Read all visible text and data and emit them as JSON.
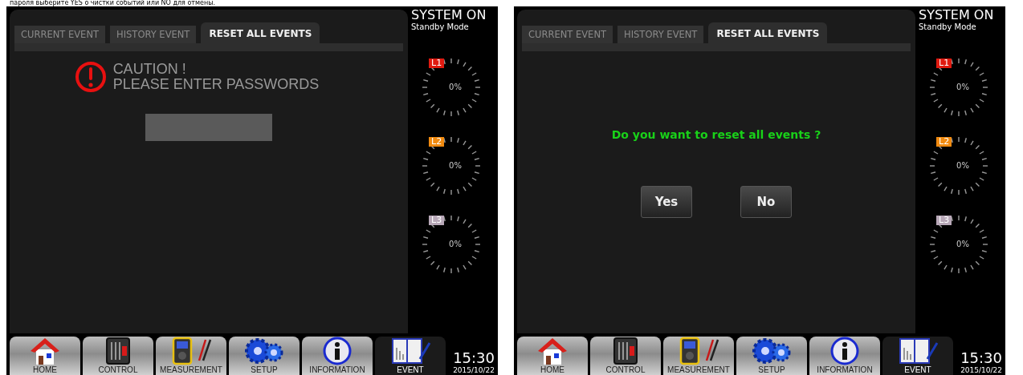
{
  "caption": "пароля выберите YES о чистки событий или NO для отмены.",
  "screens": [
    {
      "tabs": [
        {
          "label": "CURRENT EVENT",
          "selected": false
        },
        {
          "label": "HISTORY EVENT",
          "selected": false
        },
        {
          "label": "RESET ALL EVENTS",
          "selected": true
        }
      ],
      "content": {
        "kind": "password",
        "caution": "CAUTION !",
        "prompt": "PLEASE ENTER PASSWORDS"
      },
      "status": {
        "title": "SYSTEM ON",
        "mode": "Standby Mode"
      },
      "phases": [
        {
          "label": "L1",
          "color": "#e01a10",
          "reading": "0%"
        },
        {
          "label": "L2",
          "color": "#f08a10",
          "reading": "0%"
        },
        {
          "label": "L3",
          "color": "#b8a8b8",
          "reading": "0%"
        }
      ],
      "nav": [
        {
          "label": "HOME",
          "selected": false
        },
        {
          "label": "CONTROL",
          "selected": false
        },
        {
          "label": "MEASUREMENT",
          "selected": false
        },
        {
          "label": "SETUP",
          "selected": false
        },
        {
          "label": "INFORMATION",
          "selected": false
        },
        {
          "label": "EVENT",
          "selected": true
        }
      ],
      "clock": {
        "time": "15:30",
        "date": "2015/10/22"
      }
    },
    {
      "tabs": [
        {
          "label": "CURRENT EVENT",
          "selected": false
        },
        {
          "label": "HISTORY EVENT",
          "selected": false
        },
        {
          "label": "RESET ALL EVENTS",
          "selected": true
        }
      ],
      "content": {
        "kind": "confirm",
        "question": "Do you want to reset all events ?",
        "buttons": [
          "Yes",
          "No"
        ]
      },
      "status": {
        "title": "SYSTEM ON",
        "mode": "Standby Mode"
      },
      "phases": [
        {
          "label": "L1",
          "color": "#e01a10",
          "reading": "0%"
        },
        {
          "label": "L2",
          "color": "#f08a10",
          "reading": "0%"
        },
        {
          "label": "L3",
          "color": "#b8a8b8",
          "reading": "0%"
        }
      ],
      "nav": [
        {
          "label": "HOME",
          "selected": false
        },
        {
          "label": "CONTROL",
          "selected": false
        },
        {
          "label": "MEASUREMENT",
          "selected": false
        },
        {
          "label": "SETUP",
          "selected": false
        },
        {
          "label": "INFORMATION",
          "selected": false
        },
        {
          "label": "EVENT",
          "selected": true
        }
      ],
      "clock": {
        "time": "15:30",
        "date": "2015/10/22"
      }
    }
  ]
}
